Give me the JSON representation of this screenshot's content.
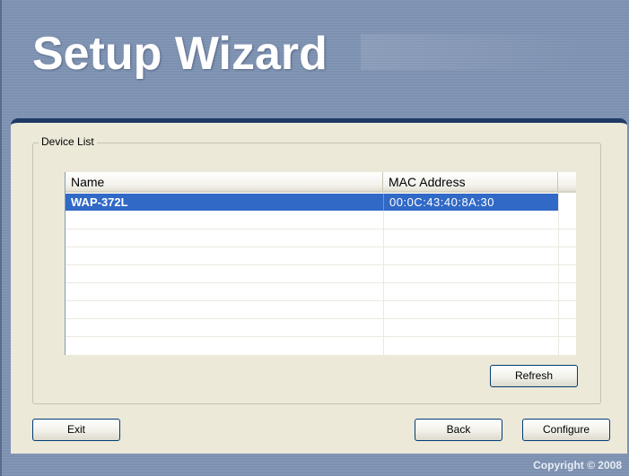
{
  "window": {
    "title": "Setup Wizard",
    "copyright": "Copyright © 2008"
  },
  "device_list": {
    "legend": "Device List",
    "columns": [
      "Name",
      "MAC Address"
    ],
    "rows": [
      {
        "name": "WAP-372L",
        "mac": "00:0C:43:40:8A:30",
        "selected": true
      }
    ]
  },
  "buttons": {
    "refresh": "Refresh",
    "exit": "Exit",
    "back": "Back",
    "configure": "Configure"
  },
  "colors": {
    "selection": "#3169c6",
    "frame": "#7c90b0",
    "panel": "#ece9d8",
    "panel_top_border": "#1f3a66"
  }
}
